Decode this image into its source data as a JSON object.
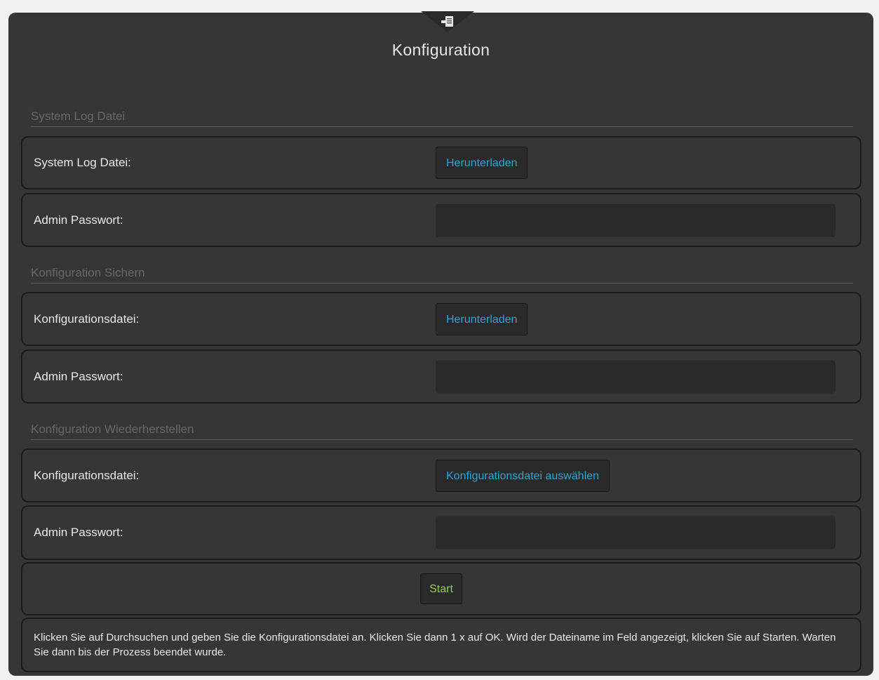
{
  "header": {
    "icon": "document-export-icon",
    "title": "Konfiguration"
  },
  "sections": {
    "syslog": {
      "title": "System Log Datei",
      "file_label": "System Log Datei:",
      "download_label": "Herunterladen",
      "password_label": "Admin Passwort:",
      "password_value": ""
    },
    "backup": {
      "title": "Konfiguration Sichern",
      "file_label": "Konfigurationsdatei:",
      "download_label": "Herunterladen",
      "password_label": "Admin Passwort:",
      "password_value": ""
    },
    "restore": {
      "title": "Konfiguration Wiederherstellen",
      "file_label": "Konfigurationsdatei:",
      "choose_label": "Konfigurationsdatei auswählen",
      "password_label": "Admin Passwort:",
      "password_value": ""
    }
  },
  "start_label": "Start",
  "info_text": "Klicken Sie auf Durchsuchen und geben Sie die Konfigurationsdatei an. Klicken Sie dann 1 x auf OK. Wird der Dateiname im Feld angezeigt, klicken Sie auf Starten. Warten Sie dann bis der Prozess beendet wurde.",
  "colors": {
    "panel": "#363636",
    "link": "#2ea3d1",
    "start": "#8fd14a"
  }
}
